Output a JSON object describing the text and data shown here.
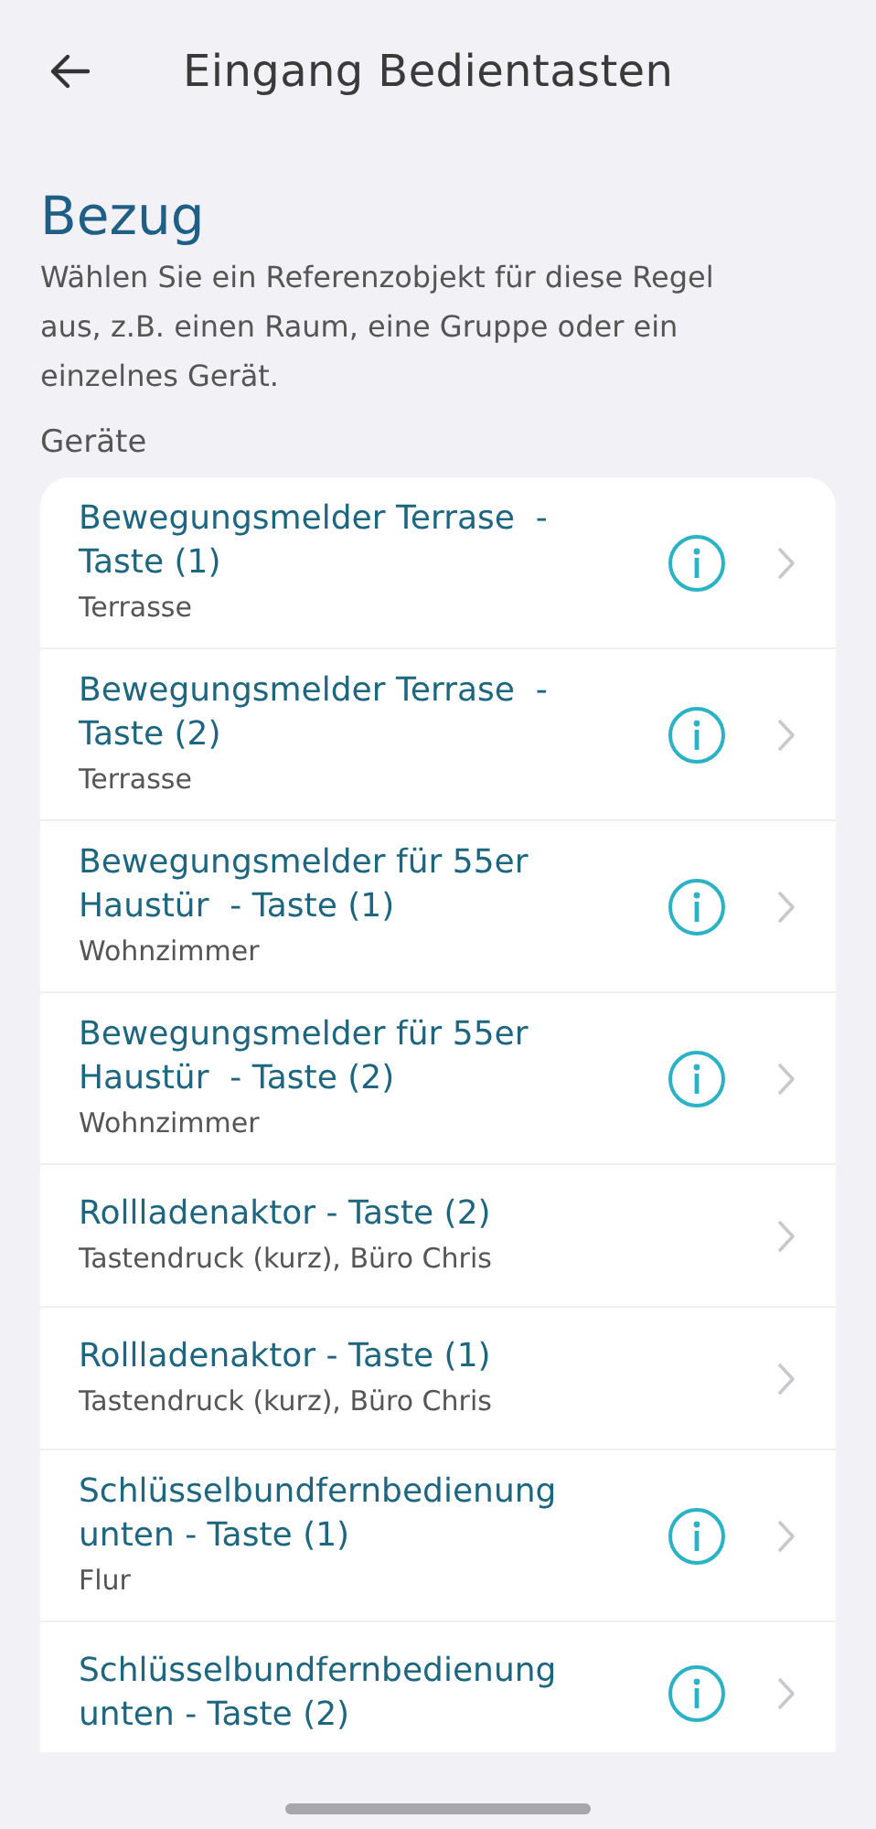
{
  "header": {
    "title": "Eingang Bedientasten"
  },
  "section": {
    "title": "Bezug",
    "description": "Wählen Sie ein Referenzobjekt für diese Regel aus, z.B. einen Raum, eine Gruppe oder ein einzelnes Gerät.",
    "group_label": "Geräte"
  },
  "devices": [
    {
      "title_lines": [
        "Bewegungsmelder Terrase  -",
        "Taste (1)"
      ],
      "subtitle": "Terrasse",
      "info": true
    },
    {
      "title_lines": [
        "Bewegungsmelder Terrase  -",
        "Taste (2)"
      ],
      "subtitle": "Terrasse",
      "info": true
    },
    {
      "title_lines": [
        "Bewegungsmelder für 55er",
        "Haustür  - Taste (1)"
      ],
      "subtitle": "Wohnzimmer",
      "info": true
    },
    {
      "title_lines": [
        "Bewegungsmelder für 55er",
        "Haustür  - Taste (2)"
      ],
      "subtitle": "Wohnzimmer",
      "info": true
    },
    {
      "title_lines": [
        "Rollladenaktor - Taste (2)"
      ],
      "subtitle": "Tastendruck (kurz), Büro Chris",
      "info": false
    },
    {
      "title_lines": [
        "Rollladenaktor - Taste (1)"
      ],
      "subtitle": "Tastendruck (kurz), Büro Chris",
      "info": false
    },
    {
      "title_lines": [
        "Schlüsselbundfernbedienung",
        "unten - Taste (1)"
      ],
      "subtitle": "Flur",
      "info": true
    },
    {
      "title_lines": [
        "Schlüsselbundfernbedienung",
        "unten - Taste (2)"
      ],
      "info": true
    }
  ]
}
